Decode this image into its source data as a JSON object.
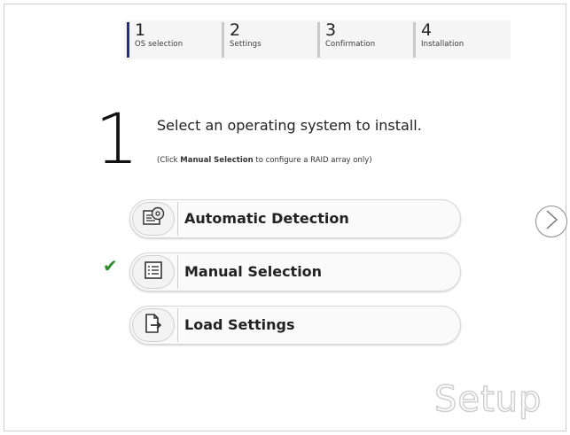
{
  "steps": [
    {
      "number": "1",
      "label": "OS selection"
    },
    {
      "number": "2",
      "label": "Settings"
    },
    {
      "number": "3",
      "label": "Confirmation"
    },
    {
      "number": "4",
      "label": "Installation"
    }
  ],
  "current_step": "1",
  "instruction": "Select an operating system to install.",
  "hint": {
    "prefix": "(Click ",
    "bold": "Manual Selection",
    "suffix": " to configure a RAID array only)"
  },
  "options": [
    {
      "label": "Automatic Detection",
      "icon": "disc-icon",
      "selected": false
    },
    {
      "label": "Manual Selection",
      "icon": "list-icon",
      "selected": true
    },
    {
      "label": "Load Settings",
      "icon": "load-file-icon",
      "selected": false
    }
  ],
  "check_mark": "✔",
  "watermark": "Setup",
  "colors": {
    "active_step": "#1e2f8f",
    "check": "#2e8b2e"
  }
}
